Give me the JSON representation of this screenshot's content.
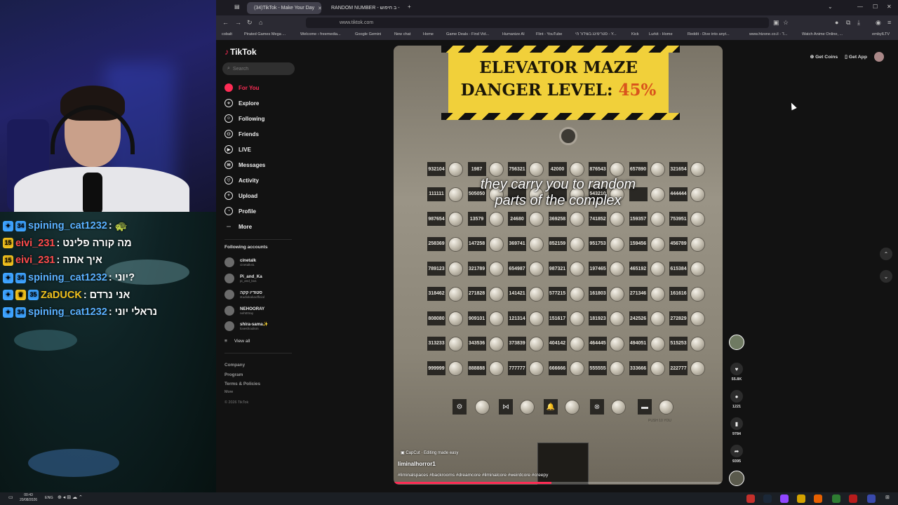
{
  "stream": {
    "chat": [
      {
        "badges": [
          "blue",
          "blue34"
        ],
        "user": "spining_cat1232",
        "sep": ":",
        "message": "🐢",
        "user_color": "#5ab0ff"
      },
      {
        "badges": [
          "gold15"
        ],
        "user": "eivi_231",
        "sep": ":",
        "message": "מה קורה פלינט",
        "user_color": "#ff4b4b"
      },
      {
        "badges": [
          "gold15"
        ],
        "user": "eivi_231",
        "sep": ":",
        "message": "איך אתה",
        "user_color": "#ff4b4b"
      },
      {
        "badges": [
          "blue",
          "blue34"
        ],
        "user": "spining_cat1232",
        "sep": ":",
        "message": "יוני?",
        "user_color": "#5ab0ff"
      },
      {
        "badges": [
          "sword",
          "crown",
          "blue35"
        ],
        "user": "ZaDUCK",
        "sep": ":",
        "message": "אני נרדם",
        "user_color": "#f2c21e"
      },
      {
        "badges": [
          "blue",
          "blue34"
        ],
        "user": "spining_cat1232",
        "sep": ":",
        "message": "נראלי יוני",
        "user_color": "#5ab0ff"
      }
    ]
  },
  "browser": {
    "tabs": [
      {
        "label": "(34)TikTok - Make Your Day",
        "active": true
      },
      {
        "label": "RANDOM NUMBER - ב חיפוש -",
        "active": false
      }
    ],
    "url": "www.tiktok.com",
    "bookmarks": [
      "cobalt",
      "Pirated Games Mega ...",
      "Welcome › freemedia...",
      "Google Gemini",
      "New chat",
      "Home",
      "Game Deals - Find Vid...",
      "Humanize AI",
      "Flint - YouTube",
      "סטרימינג בשידור חי - Y...",
      "Kick",
      "Lurkit - Home",
      "Reddit - Dive into anyt...",
      "www.htzone.co.il - ד...",
      "Watch Anime Online, ...",
      "embyILTV"
    ]
  },
  "tiktok": {
    "logo": "TikTok",
    "search_placeholder": "Search",
    "nav": [
      {
        "label": "For You",
        "icon": "home-icon",
        "active": true
      },
      {
        "label": "Explore",
        "icon": "compass-icon",
        "active": false
      },
      {
        "label": "Following",
        "icon": "following-icon",
        "active": false
      },
      {
        "label": "Friends",
        "icon": "friends-icon",
        "active": false
      },
      {
        "label": "LIVE",
        "icon": "live-icon",
        "active": false
      },
      {
        "label": "Messages",
        "icon": "messages-icon",
        "active": false
      },
      {
        "label": "Activity",
        "icon": "activity-icon",
        "active": false
      },
      {
        "label": "Upload",
        "icon": "upload-icon",
        "active": false
      },
      {
        "label": "Profile",
        "icon": "profile-icon",
        "active": false
      },
      {
        "label": "More",
        "icon": "more-icon",
        "active": false
      }
    ],
    "following_title": "Following accounts",
    "accounts": [
      {
        "name": "cinetalk",
        "handle": "cinetalk41"
      },
      {
        "name": "Pi_and_Ka",
        "handle": "pi_and_ka1"
      },
      {
        "name": "סטודיו קקה",
        "handle": "studiokakaofficial"
      },
      {
        "name": "NEHOORAY",
        "handle": "neh00ray"
      },
      {
        "name": "shira-sama✨",
        "handle": "loveshoulism"
      }
    ],
    "view_all": "View all",
    "footer": [
      "Company",
      "Program",
      "Terms & Policies",
      "More"
    ],
    "copyright": "© 2026 TikTok",
    "top_actions": {
      "coins": "Get Coins",
      "app": "Get App"
    }
  },
  "video": {
    "sign_title": "ELEVATOR MAZE",
    "sign_danger": "DANGER LEVEL:",
    "sign_level": "45%",
    "caption_line1": "they carry you to random",
    "caption_line2": "parts of the complex",
    "panel_rows": [
      [
        "932104",
        "1987",
        "756321",
        "42000",
        "876543",
        "657890",
        "321654"
      ],
      [
        "111111",
        "505050",
        "",
        "",
        "543210",
        "",
        "444444"
      ],
      [
        "987654",
        "13579",
        "24680",
        "369258",
        "741852",
        "159357",
        "753951"
      ],
      [
        "258369",
        "147258",
        "369741",
        "852159",
        "951753",
        "159456",
        "456789"
      ],
      [
        "789123",
        "321789",
        "654987",
        "987321",
        "197465",
        "465192",
        "615384"
      ],
      [
        "318462",
        "271828",
        "141421",
        "577215",
        "161803",
        "271346",
        "161616"
      ],
      [
        "808080",
        "909101",
        "121314",
        "151617",
        "181923",
        "242526",
        "272829"
      ],
      [
        "313233",
        "343536",
        "373839",
        "404142",
        "464445",
        "494051",
        "515253"
      ],
      [
        "999999",
        "888888",
        "777777",
        "666666",
        "555555",
        "333666",
        "222777"
      ]
    ],
    "bottom_symbols": [
      "⚙",
      "⋈",
      "🔔",
      "⊗",
      "▬"
    ],
    "fine_print": "PUSH 10 YOU",
    "capcut": "CapCut · Editing made easy",
    "author": "liminalhorror1",
    "hashtags": "#liminalspaces #backrooms #dreamcore #liminalcore #weirdcore #creepy",
    "progress": 0.48
  },
  "rail": {
    "likes": "55.8K",
    "comments": "1221",
    "saves": "9784",
    "shares": "9395"
  },
  "taskbar": {
    "time": "00:43",
    "date": "20/08/2026",
    "lang": "ENG"
  }
}
